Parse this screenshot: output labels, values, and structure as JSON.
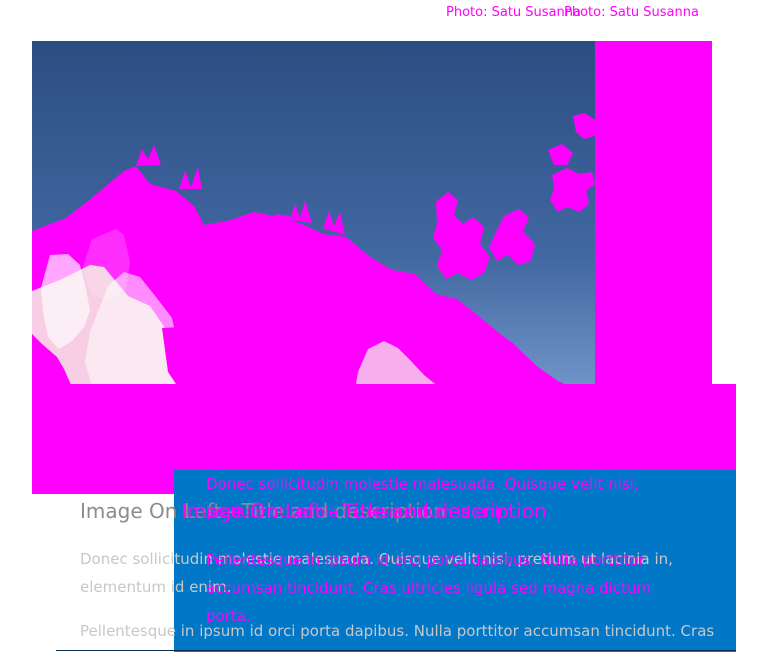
{
  "photo_credit": {
    "first": "Photo: Satu Susanna",
    "second": "Photo: Satu Susanna"
  },
  "hero": {
    "icon": "building-icon"
  },
  "card": {
    "title": "Image On Left - Title and description",
    "paragraph_1": "Donec sollicitudin molestie malesuada. Quisque velit nisi, pretium ut lacinia in, elementum id enim.",
    "paragraph_2": "Pellentesque in ipsum id orci porta dapibus. Nulla porttitor accumsan tincidunt. Cras ultricies ligula sed magna dictum porta."
  },
  "colors": {
    "magenta": "#ff00ff",
    "blue": "#0077c7",
    "sky": "#3f67a0"
  }
}
